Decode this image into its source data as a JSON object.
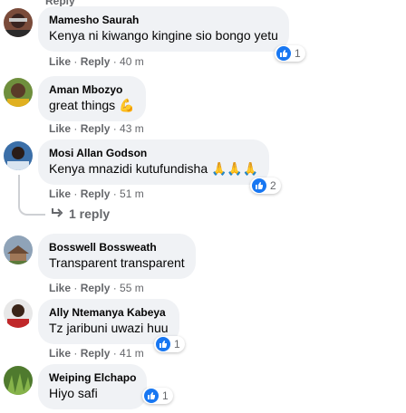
{
  "top_fragment": "Reply",
  "labels": {
    "like": "Like",
    "reply": "Reply"
  },
  "comments": [
    {
      "author": "Mamesho Saurah",
      "text": "Kenya ni kiwango kingine sio bongo yetu",
      "time": "40 m",
      "reactions": "1"
    },
    {
      "author": "Aman Mbozyo",
      "text": "great things",
      "emoji": "💪",
      "time": "43 m"
    },
    {
      "author": "Mosi Allan Godson",
      "text": "Kenya mnazidi kutufundisha",
      "emoji": "🙏🙏🙏",
      "time": "51 m",
      "reactions": "2"
    },
    {
      "author": "Bosswell Bossweath",
      "text": "Transparent transparent",
      "time": "55 m"
    },
    {
      "author": "Ally Ntemanya Kabeya",
      "text": "Tz jaribuni uwazi huu",
      "time": "41 m",
      "reactions": "1"
    },
    {
      "author": "Weiping Elchapo",
      "text": "Hiyo safi",
      "reactions": "1"
    }
  ],
  "replies_link": "1 reply",
  "icons": {
    "reaction": "like-icon",
    "replies": "reply-arrow-icon"
  },
  "colors": {
    "bubble": "#f0f2f5",
    "meta": "#65676b",
    "accent": "#1877f2"
  }
}
